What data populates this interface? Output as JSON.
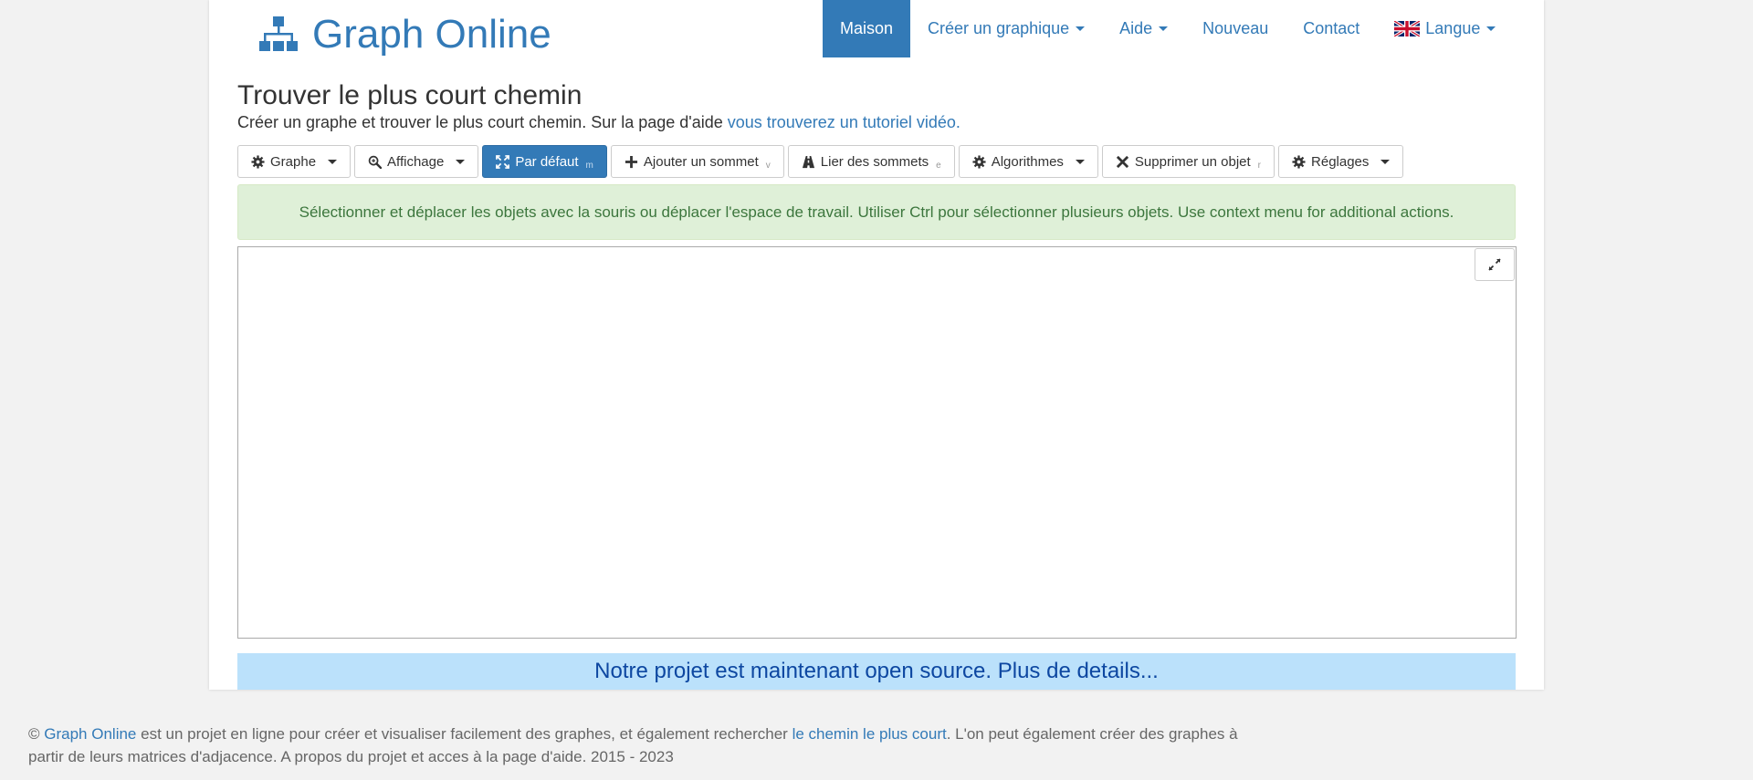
{
  "brand": {
    "title": "Graph Online",
    "icon": "sitemap-icon",
    "color": "#337ab7"
  },
  "nav": {
    "items": [
      {
        "label": "Maison",
        "active": true
      },
      {
        "label": "Créer un graphique",
        "dropdown": true
      },
      {
        "label": "Aide",
        "dropdown": true
      },
      {
        "label": "Nouveau"
      },
      {
        "label": "Contact"
      },
      {
        "label": "Langue",
        "dropdown": true,
        "icon": "uk-flag-icon"
      }
    ]
  },
  "header": {
    "title": "Trouver le plus court chemin",
    "subtitle_text": "Créer un graphe et trouver le plus court chemin. Sur la page d'aide ",
    "subtitle_link": "vous trouverez un tutoriel vidéo."
  },
  "toolbar": {
    "graph": {
      "label": "Graphe",
      "icon": "gear-icon"
    },
    "view": {
      "label": "Affichage",
      "icon": "zoom-icon"
    },
    "default": {
      "label": "Par défaut",
      "hotkey": "m",
      "icon": "move-icon"
    },
    "add_vertex": {
      "label": "Ajouter un sommet",
      "hotkey": "v",
      "icon": "plus-icon"
    },
    "connect": {
      "label": "Lier des sommets",
      "hotkey": "e",
      "icon": "road-icon"
    },
    "algorithms": {
      "label": "Algorithmes",
      "icon": "gear-icon"
    },
    "delete": {
      "label": "Supprimer un objet",
      "hotkey": "r",
      "icon": "close-icon"
    },
    "settings": {
      "label": "Réglages",
      "icon": "gear-icon"
    }
  },
  "alert": {
    "text": "Sélectionner et déplacer les objets avec la souris ou déplacer l'espace de travail. Utiliser Ctrl pour sélectionner plusieurs objets. Use context menu for additional actions."
  },
  "canvas": {
    "fullscreen_icon": "expand-icon"
  },
  "banner": {
    "text": "Notre projet est maintenant open source. Plus de details..."
  },
  "footer": {
    "copyright": "©",
    "brand_link": "Graph Online",
    "text1": " est un projet en ligne pour créer et visualiser facilement des graphes, et également rechercher ",
    "link2": "le chemin le plus court",
    "text2": ". L'on peut également créer des graphes à",
    "line2": "partir de leurs matrices d'adjacence. A propos du projet et acces à la page d'aide. 2015 - 2023"
  },
  "colors": {
    "primary": "#337ab7",
    "alert_bg": "#dff0d8",
    "alert_text": "#3c763d",
    "banner_bg": "#bbe1fb",
    "banner_text": "#0d47a1"
  }
}
